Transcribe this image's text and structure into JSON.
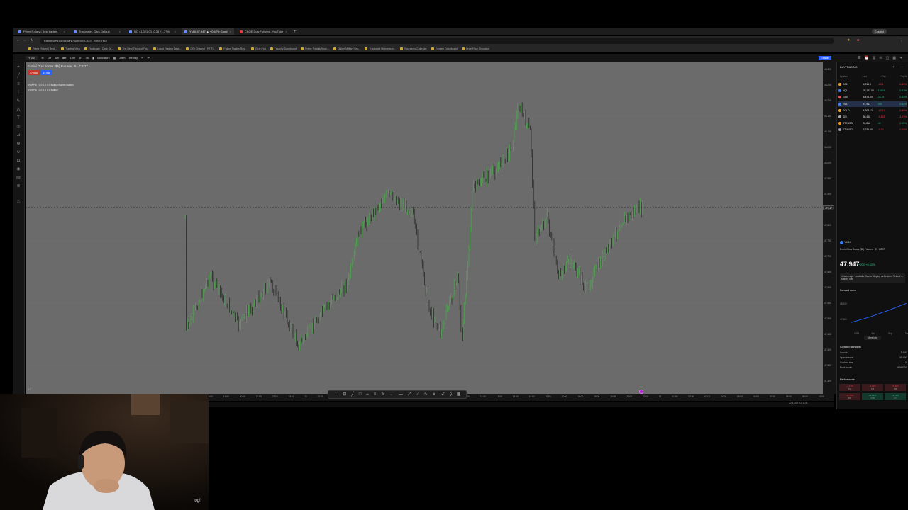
{
  "browser": {
    "tabs": [
      {
        "label": "Prime Rotary | Best traders",
        "active": false
      },
      {
        "label": "Tradovate - Dark Default",
        "active": false
      },
      {
        "label": "NQ 41,321.03 -0.38 +1.77%",
        "active": false
      },
      {
        "label": "YM1! 47,947 ▲ +0.42% Good",
        "active": true
      },
      {
        "label": "CBOE Dow Futures - YouTube",
        "active": false
      }
    ],
    "new_tab": "+",
    "profile": "Graded",
    "url": "tradingview.com/chart/?symbol=CBOT_MINI:YM1!",
    "bookmarks": [
      "Prime Rotary | Best...",
      "Trading View",
      "Tradovate - Dark De...",
      "The Best Types of Pol...",
      "Lucid Trading Dash...",
      "ORI Channel | PT Ti...",
      "Follow Trades Reg...",
      "Blue Fog",
      "Tradeify Dashboard",
      "Prime TradingBook...",
      "Online Military Dra...",
      "Tradeable Momentum...",
      "Economic Calendar",
      "Topstep Dashboard",
      "OrderFlow Simulator"
    ]
  },
  "toolbar": {
    "symbol": "YM1!",
    "timeframes": [
      "1m",
      "3m",
      "5m",
      "15m",
      "1h",
      "4h"
    ],
    "indicators": "Indicators",
    "alert": "Alert",
    "replay": "Replay",
    "trade": "Trade"
  },
  "chart": {
    "title": "E-mini Dow Jones ($5) Futures · 5 · CBOT",
    "sell_price": "47,946",
    "buy_price": "47,948",
    "indicator_1": "VWAP 5 · 0.0 0.0 0.0 Bullish Bullish Bullish",
    "indicator_2": "VWAP 5 · 0.0 0.0 0.0 Bullish",
    "current_price": "47,947",
    "fps": "17",
    "timezone": "22:14:02 (UTC-5)",
    "y_ticks": [
      "48,300",
      "48,250",
      "48,200",
      "48,150",
      "48,100",
      "48,050",
      "48,000",
      "47,950",
      "47,900",
      "47,850",
      "47,800",
      "47,750",
      "47,700",
      "47,650",
      "47,600",
      "47,550",
      "47,500",
      "47,450",
      "47,400",
      "47,350",
      "47,300"
    ],
    "x_ticks": [
      "18:00",
      "19:00",
      "20:00",
      "21:00",
      "22:00",
      "23:00",
      "11",
      "01:00",
      "02:00",
      "03:00",
      "04:00",
      "05:00",
      "06:00",
      "07:00",
      "08:00",
      "09:00",
      "10:00",
      "11:00",
      "12:00",
      "13:00",
      "14:00",
      "15:00",
      "16:00",
      "18:00",
      "19:00",
      "20:00",
      "21:00",
      "22:00",
      "12",
      "01:00",
      "02:00",
      "03:00",
      "04:00",
      "05:00",
      "06:00",
      "07:00",
      "08:00",
      "09:00",
      "10:00"
    ],
    "colors": {
      "up": "#4ca64c",
      "down": "#2b2b2b",
      "bg": "#6b6b6b"
    }
  },
  "watchlist": {
    "title": "DAYTRADING",
    "columns": [
      "Symbol",
      "Last",
      "Chg",
      "Chg%"
    ],
    "rows": [
      {
        "symbol": "GC1!",
        "last": "4,216.0",
        "chg": "-19.1",
        "pct": "-0.45%",
        "dot": "#f0a030",
        "up": false
      },
      {
        "symbol": "NQ1!",
        "last": "25,192.00",
        "chg": "116.00",
        "pct": "0.47%",
        "dot": "#3b82f6",
        "up": true
      },
      {
        "symbol": "ES1!",
        "last": "6,876.00",
        "chg": "22.25",
        "pct": "0.33%",
        "dot": "#e05050",
        "up": true
      },
      {
        "symbol": "YM1!",
        "last": "47,947",
        "chg": "200",
        "pct": "0.42%",
        "dot": "#3b82f6",
        "up": true,
        "selected": true
      },
      {
        "symbol": "GOLD",
        "last": "4,208.12",
        "chg": "-19.11",
        "pct": "-0.45%",
        "dot": "#f0a030",
        "up": false
      },
      {
        "symbol": "SI1!",
        "last": "58.460",
        "chg": "-1.829",
        "pct": "-3.03%",
        "dot": "#aaaaaa",
        "up": false
      },
      {
        "symbol": "BTCUSD",
        "last": "92,816",
        "chg": "49",
        "pct": "0.05%",
        "dot": "#f7931a",
        "up": true
      },
      {
        "symbol": "ETHUSD",
        "last": "3,226.40",
        "chg": "-5.70",
        "pct": "-0.18%",
        "dot": "#8a92b2",
        "up": false
      }
    ]
  },
  "details": {
    "symbol": "YM1!",
    "name": "E-mini Dow Jones ($5) Futures · 5 · CBOT",
    "price": "47,947",
    "unit": "USD",
    "change": "+200 +0.42%",
    "news": "4 hours ago · Australia Shares Slipping as Lenders Retreat — Market Talk",
    "forward_curve_title": "Forward curve",
    "forward_curve_labels": [
      "48,000",
      "47,500"
    ],
    "forward_curve_months": [
      "2026",
      "Jun",
      "Sep",
      "Dec"
    ],
    "forward_curve_values": [
      47947,
      48120,
      48330,
      48560
    ],
    "more_info": "More info",
    "highlights_title": "Contract highlights",
    "highlights": [
      {
        "label": "Volume",
        "value": "3.46K"
      },
      {
        "label": "Open interest",
        "value": "49.44K"
      },
      {
        "label": "Contract size",
        "value": "5"
      },
      {
        "label": "Front month",
        "value": "YMH2026"
      }
    ],
    "performance_title": "Performance",
    "performance": [
      {
        "value": "-1.17%",
        "period": "1W",
        "up": false
      },
      {
        "value": "-1.03%",
        "period": "1M",
        "up": false
      },
      {
        "value": "-0.66%",
        "period": "3M",
        "up": false
      },
      {
        "value": "-11.75%",
        "period": "6M",
        "up": false
      },
      {
        "value": "+2.24%",
        "period": "YTD",
        "up": true
      },
      {
        "value": "+9.13%",
        "period": "1Y",
        "up": true
      }
    ]
  },
  "webcam": {
    "label": "log!"
  }
}
